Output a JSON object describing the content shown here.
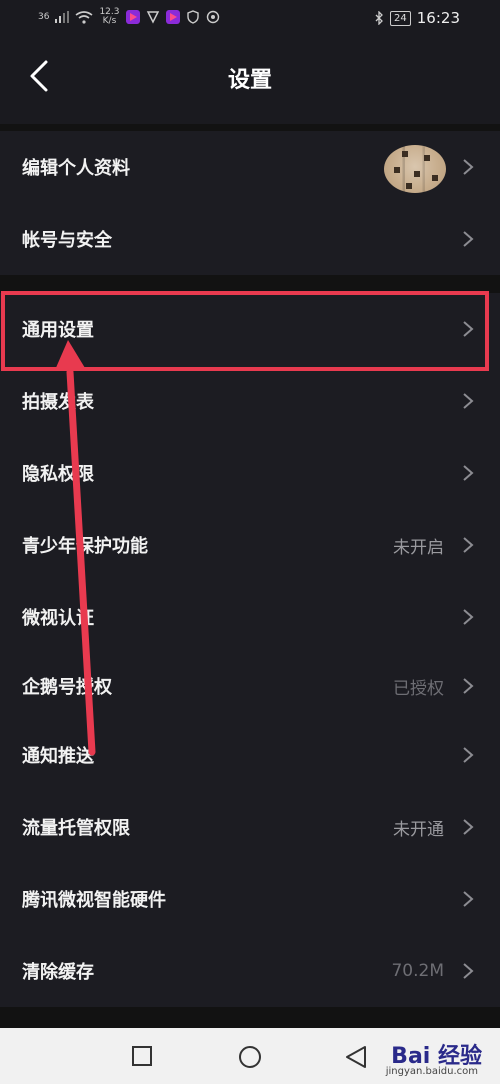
{
  "status_bar": {
    "signal": "36",
    "net_speed": "12.3",
    "net_unit": "K/s",
    "battery": "24",
    "time": "16:23"
  },
  "header": {
    "title": "设置"
  },
  "groups": [
    {
      "items": [
        {
          "label": "编辑个人资料",
          "value": ""
        },
        {
          "label": "帐号与安全",
          "value": ""
        }
      ]
    },
    {
      "items": [
        {
          "label": "通用设置",
          "value": ""
        },
        {
          "label": "拍摄发表",
          "value": ""
        },
        {
          "label": "隐私权限",
          "value": ""
        },
        {
          "label": "青少年保护功能",
          "value": "未开启"
        },
        {
          "label": "微视认证",
          "value": ""
        },
        {
          "label": "企鹅号授权",
          "value": "已授权"
        },
        {
          "label": "通知推送",
          "value": ""
        },
        {
          "label": "流量托管权限",
          "value": "未开通"
        },
        {
          "label": "腾讯微视智能硬件",
          "value": ""
        },
        {
          "label": "清除缓存",
          "value": "70.2M"
        }
      ]
    }
  ],
  "watermark": {
    "brand": "Bai 经验",
    "url": "jingyan.baidu.com"
  },
  "colors": {
    "accent": "#e83a4f",
    "bg": "#1c1c22"
  }
}
